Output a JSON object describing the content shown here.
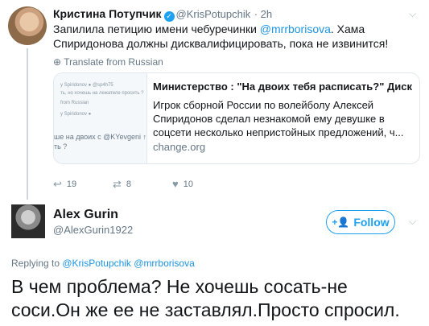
{
  "tweet": {
    "author_name": "Кристина Потупчик",
    "author_handle": "@KrisPotupchik",
    "time": "· 2h",
    "text_a": "Запилила петицию имени чебуречинки ",
    "mention": "@mrrborisova",
    "text_b": ". Хама Спиридонова должны дисквалифицировать, пока не извинится!",
    "translate_label": "Translate from Russian",
    "card": {
      "title": "Министерство : \"На двоих тебя расписать?\" Диск...",
      "description": "Игрок сборной России по волейболу Алексей Спиридонов сделал незнакомой ему девушке в соцсети несколько непристойных предложений, ч...",
      "domain": "change.org",
      "thumb_lines": [
        "y Spiridonov ●  @sp4h75",
        "ть, но хочешь на лежателе просить ?",
        "from Russian",
        "y Spiridonov ●",
        "ше на двоих с @KYevgeni ↑",
        "ть ?"
      ]
    },
    "actions": {
      "reply_count": "19",
      "retweet_count": "8",
      "like_count": "10"
    }
  },
  "profile": {
    "name": "Alex Gurin",
    "handle": "@AlexGurin1922",
    "follow_label": "Follow"
  },
  "reply": {
    "replying_prefix": "Replying to ",
    "replying_handles": "@KrisPotupchik @mrrborisova",
    "text": "В чем проблема? Не хочешь сосать-не соси.Он же ее не заставлял.Просто спросил."
  },
  "colors": {
    "accent": "#1da1f2",
    "link": "#1b95e0",
    "muted": "#657786"
  }
}
